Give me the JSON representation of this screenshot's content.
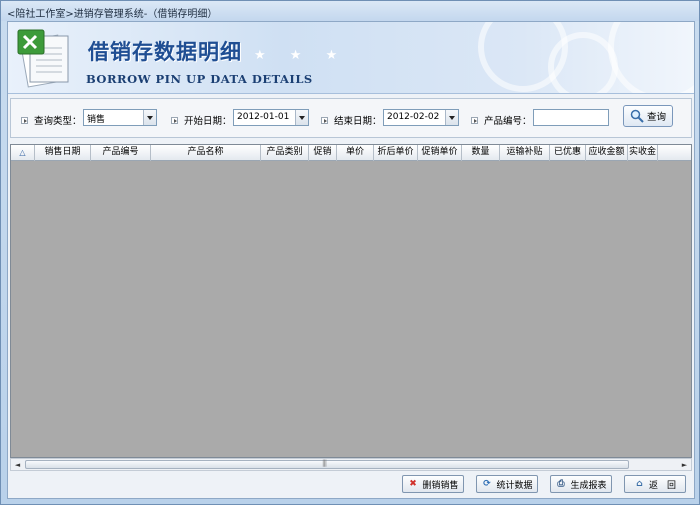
{
  "window": {
    "title": "<陪社工作室>进销存管理系统-（借销存明细）"
  },
  "banner": {
    "title_cn": "借销存数据明细",
    "title_en": "BORROW PIN UP DATA DETAILS",
    "stars": "★ ★ ★"
  },
  "query": {
    "type_label": "查询类型：",
    "type_value": "销售",
    "start_label": "开始日期：",
    "start_value": "2012-01-01",
    "end_label": "结束日期：",
    "end_value": "2012-02-02",
    "product_label": "产品编号：",
    "product_value": "",
    "search_button": "查询"
  },
  "grid": {
    "row_header_glyph": "△",
    "columns": [
      "销售日期",
      "产品编号",
      "产品名称",
      "产品类别",
      "促销",
      "单价",
      "折后单价",
      "促销单价",
      "数量",
      "运输补贴",
      "已优惠",
      "应收金额",
      "实收金"
    ],
    "rows": []
  },
  "scrollbar": {
    "left": "◄",
    "right": "►"
  },
  "actions": {
    "delete": "删销销售",
    "stats": "统计数据",
    "report": "生成报表",
    "back": "返　回"
  },
  "colors": {
    "banner_title": "#1f4e93",
    "grid_background": "#aaaaaa",
    "delete_icon": "#d0302a"
  }
}
